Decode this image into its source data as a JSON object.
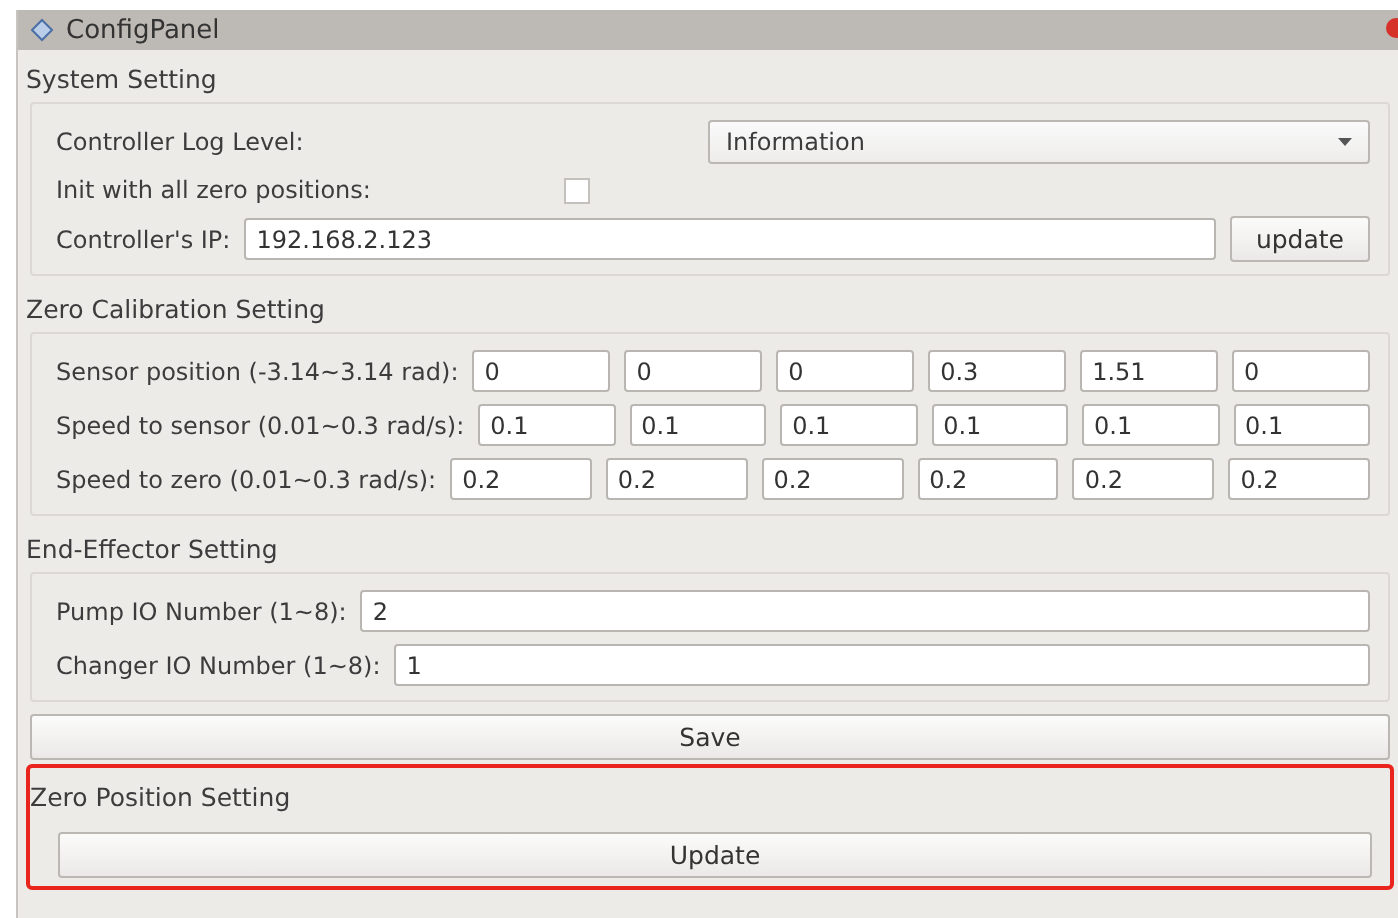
{
  "window": {
    "title": "ConfigPanel"
  },
  "system_setting": {
    "title": "System Setting",
    "log_level": {
      "label": "Controller Log Level:",
      "value": "Information"
    },
    "init_zero": {
      "label": "Init with all zero positions:",
      "checked": false
    },
    "ip": {
      "label": "Controller's IP:",
      "value": "192.168.2.123",
      "button": "update"
    }
  },
  "zero_calibration": {
    "title": "Zero Calibration Setting",
    "rows": [
      {
        "label": "Sensor position (-3.14~3.14 rad):",
        "values": [
          "0",
          "0",
          "0",
          "0.3",
          "1.51",
          "0"
        ]
      },
      {
        "label": "Speed to sensor (0.01~0.3 rad/s):",
        "values": [
          "0.1",
          "0.1",
          "0.1",
          "0.1",
          "0.1",
          "0.1"
        ]
      },
      {
        "label": "Speed to zero (0.01~0.3 rad/s):",
        "values": [
          "0.2",
          "0.2",
          "0.2",
          "0.2",
          "0.2",
          "0.2"
        ]
      }
    ]
  },
  "end_effector": {
    "title": "End-Effector Setting",
    "rows": [
      {
        "label": "Pump IO Number (1~8):",
        "value": "2"
      },
      {
        "label": "Changer IO Number (1~8):",
        "value": "1"
      }
    ]
  },
  "save_button": "Save",
  "zero_position": {
    "title": "Zero Position Setting",
    "button": "Update",
    "highlighted": true
  }
}
